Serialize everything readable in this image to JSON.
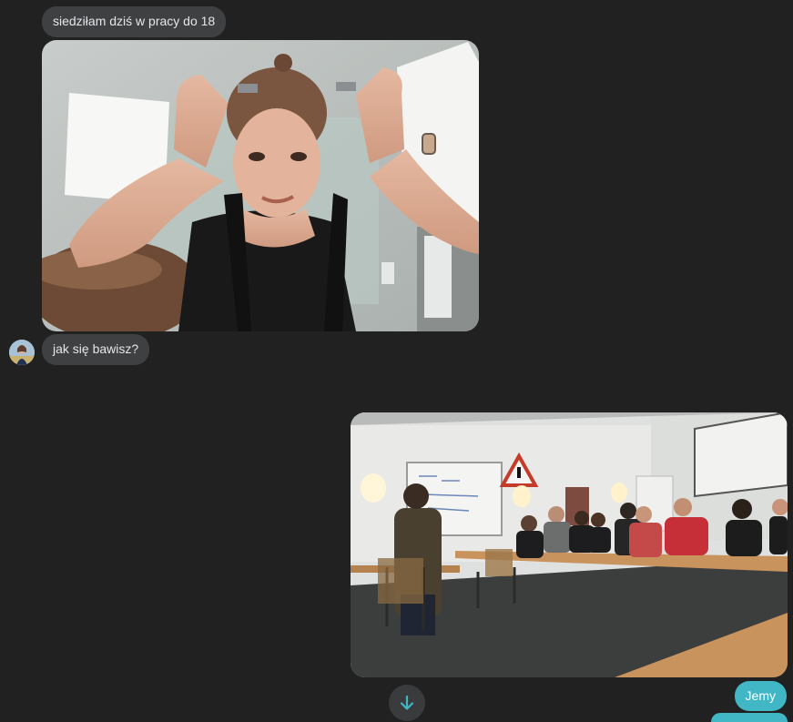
{
  "messages": [
    {
      "id": "msg1",
      "direction": "incoming",
      "text": "siedziłam dziś w pracy do 18"
    },
    {
      "id": "msg2",
      "direction": "incoming",
      "text": "jak się bawisz?"
    },
    {
      "id": "msg3",
      "direction": "outgoing",
      "text": "Jemy"
    }
  ],
  "colors": {
    "background": "#212121",
    "incoming_bubble": "#3e4042",
    "outgoing_bubble": "#41b6c4"
  },
  "icons": {
    "scroll_down": "arrow-down-icon"
  }
}
